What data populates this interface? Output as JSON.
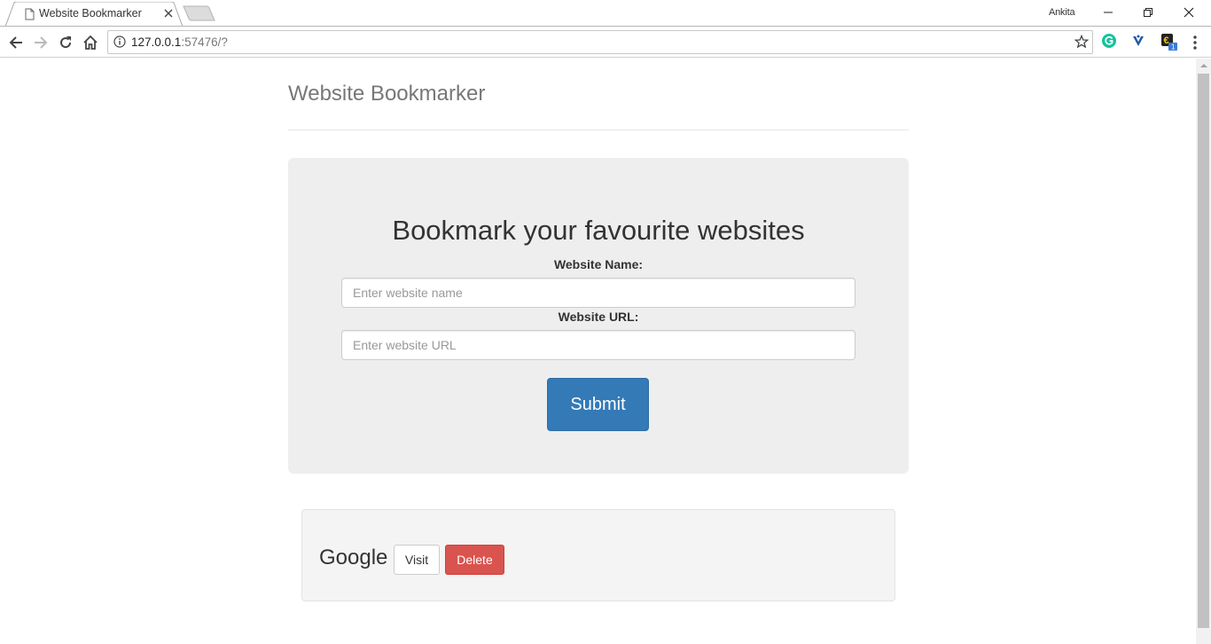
{
  "browser": {
    "tab_title": "Website Bookmarker",
    "profile_name": "Ankita",
    "url_host": "127.0.0.1",
    "url_path": ":57476/?",
    "extension_badge": "1"
  },
  "page": {
    "site_title": "Website Bookmarker",
    "jumbotron": {
      "heading": "Bookmark your favourite websites",
      "name_label": "Website Name:",
      "name_placeholder": "Enter website name",
      "url_label": "Website URL:",
      "url_placeholder": "Enter website URL",
      "submit_label": "Submit"
    },
    "bookmarks": [
      {
        "name": "Google",
        "visit_label": "Visit",
        "delete_label": "Delete"
      }
    ]
  },
  "colors": {
    "primary": "#337ab7",
    "danger": "#d9534f",
    "jumbotron_bg": "#eeeeee",
    "well_bg": "#f4f4f4"
  }
}
